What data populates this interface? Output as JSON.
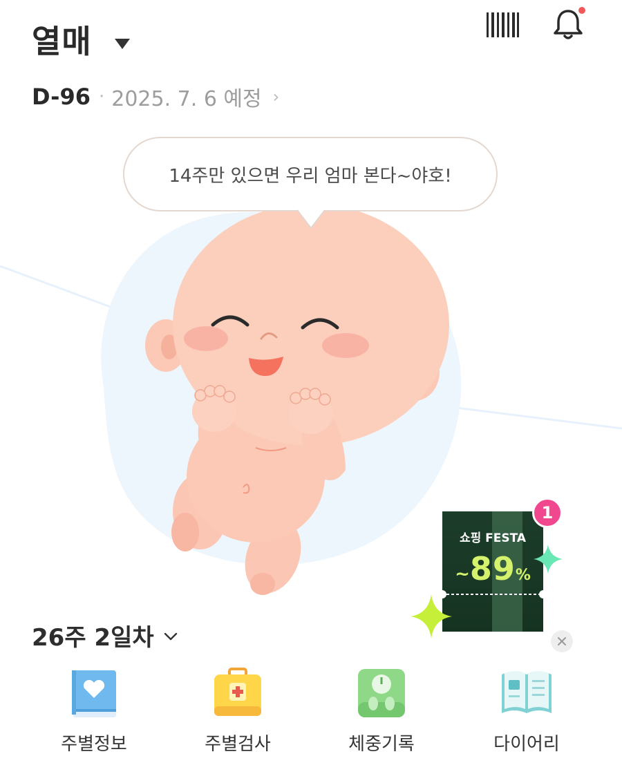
{
  "header": {
    "title": "열매",
    "dday": "D-96",
    "separator": "·",
    "due_date": "2025. 7. 6 예정",
    "chevron": "›"
  },
  "bubble": {
    "message": "14주만 있으면 우리 엄마 본다~야호!"
  },
  "week": {
    "label": "26주 2일차"
  },
  "promo": {
    "title": "쇼핑 FESTA",
    "tilde": "~",
    "discount": "89",
    "percent": "%",
    "badge_count": "1",
    "colors": {
      "bg": "#1d3a28",
      "accent": "#d5f26c",
      "badge": "#f0478f"
    }
  },
  "menu": [
    {
      "label": "주별정보",
      "icon": "book-heart-icon"
    },
    {
      "label": "주별검사",
      "icon": "first-aid-kit-icon"
    },
    {
      "label": "체중기록",
      "icon": "scale-icon"
    },
    {
      "label": "다이어리",
      "icon": "diary-icon"
    }
  ],
  "icons": {
    "barcode": "barcode-icon",
    "bell": "bell-icon",
    "notification_dot": "#f0585a"
  }
}
